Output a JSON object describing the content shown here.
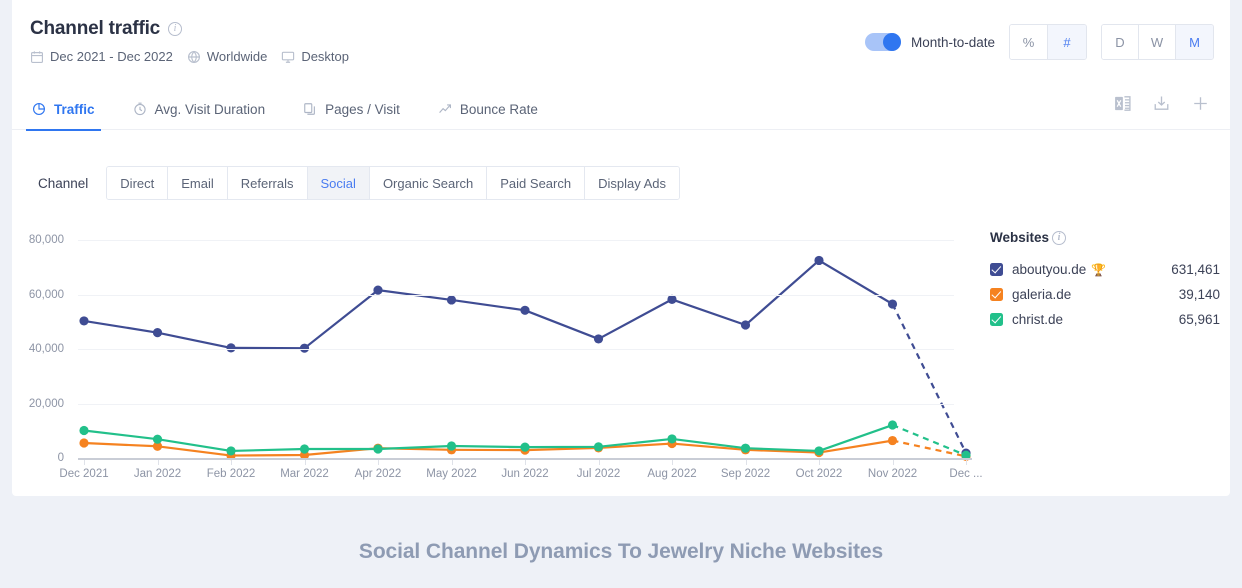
{
  "header": {
    "title": "Channel traffic",
    "info_icon": "info-icon",
    "meta": {
      "date_range": "Dec 2021 - Dec 2022",
      "date_icon": "calendar-icon",
      "location": "Worldwide",
      "location_icon": "globe-icon",
      "device": "Desktop",
      "device_icon": "monitor-icon"
    },
    "controls": {
      "toggle_label": "Month-to-date",
      "toggle_on": true,
      "unit_options": [
        "%",
        "#"
      ],
      "unit_selected": "#",
      "period_options": [
        "D",
        "W",
        "M"
      ],
      "period_selected": "M"
    }
  },
  "tabs": [
    {
      "label": "Traffic",
      "icon": "traffic-pie-icon",
      "active": true
    },
    {
      "label": "Avg. Visit Duration",
      "icon": "clock-icon",
      "active": false
    },
    {
      "label": "Pages / Visit",
      "icon": "pages-icon",
      "active": false
    },
    {
      "label": "Bounce Rate",
      "icon": "bounce-rate-icon",
      "active": false
    }
  ],
  "tools": [
    {
      "name": "export-excel-icon",
      "label": "Export to Excel"
    },
    {
      "name": "download-icon",
      "label": "Download"
    },
    {
      "name": "plus-icon",
      "label": "Add"
    }
  ],
  "channel_filter": {
    "label": "Channel",
    "options": [
      "Direct",
      "Email",
      "Referrals",
      "Social",
      "Organic Search",
      "Paid Search",
      "Display Ads"
    ],
    "selected": "Social"
  },
  "legend": {
    "title": "Websites",
    "info_icon": "info-icon",
    "items": [
      {
        "name": "aboutyou.de",
        "value": "631,461",
        "color": "#3f4c93",
        "checked": true,
        "badge": "🏆"
      },
      {
        "name": "galeria.de",
        "value": "39,140",
        "color": "#f58220",
        "checked": true,
        "badge": ""
      },
      {
        "name": "christ.de",
        "value": "65,961",
        "color": "#22c08a",
        "checked": true,
        "badge": ""
      }
    ]
  },
  "caption": "Social Channel Dynamics To Jewelry Niche Websites",
  "chart_data": {
    "type": "line",
    "title": "Channel traffic",
    "xlabel": "",
    "ylabel": "",
    "ylim": [
      0,
      80000
    ],
    "yticks": [
      0,
      20000,
      40000,
      60000,
      80000
    ],
    "ytick_labels": [
      "0",
      "20,000",
      "40,000",
      "60,000",
      "80,000"
    ],
    "grid": true,
    "legend_position": "right",
    "categories": [
      "Dec 2021",
      "Jan 2022",
      "Feb 2022",
      "Mar 2022",
      "Apr 2022",
      "May 2022",
      "Jun 2022",
      "Jul 2022",
      "Aug 2022",
      "Sep 2022",
      "Oct 2022",
      "Nov 2022",
      "Dec ..."
    ],
    "projected_from_index": 11,
    "series": [
      {
        "name": "aboutyou.de",
        "color": "#3f4c93",
        "values": [
          50300,
          46000,
          40400,
          40300,
          61600,
          58000,
          54200,
          43700,
          58200,
          48800,
          72500,
          56500,
          1800
        ]
      },
      {
        "name": "galeria.de",
        "color": "#f58220",
        "values": [
          5500,
          4300,
          900,
          1100,
          3600,
          3000,
          2900,
          3700,
          5300,
          3000,
          2000,
          6400,
          600
        ]
      },
      {
        "name": "christ.de",
        "color": "#22c08a",
        "values": [
          10100,
          6900,
          2600,
          3300,
          3300,
          4400,
          4000,
          4100,
          7000,
          3600,
          2600,
          12100,
          1000
        ]
      }
    ]
  }
}
